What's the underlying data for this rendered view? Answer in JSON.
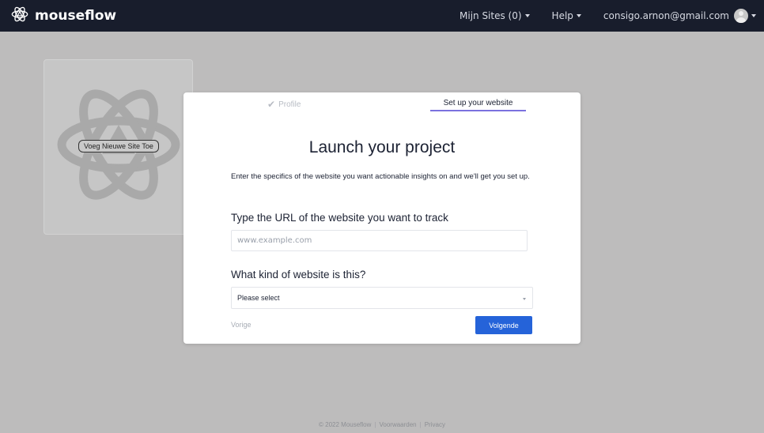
{
  "topbar": {
    "brand": "mouseflow",
    "logo_icon": "atom-logo-icon",
    "nav": {
      "sites": "Mijn Sites (0)",
      "help": "Help",
      "account": "consigo.arnon@gmail.com"
    }
  },
  "background": {
    "add_site_label": "Voeg Nieuwe Site Toe"
  },
  "wizard": {
    "steps": {
      "profile": "Profile",
      "website": "Set up your website"
    },
    "title": "Launch your project",
    "description": "Enter the specifics of the website you want actionable insights on and we'll get you set up.",
    "url_label": "Type the URL of the website you want to track",
    "url_placeholder": "www.example.com",
    "url_value": "",
    "kind_label": "What kind of website is this?",
    "kind_selected": "Please select",
    "prev_label": "Vorige",
    "next_label": "Volgende"
  },
  "footer": {
    "copyright": "© 2022 Mouseflow",
    "terms": "Voorwaarden",
    "privacy": "Privacy"
  },
  "colors": {
    "topbar": "#181d2c",
    "accent_underline": "#7b71df",
    "primary_button": "#2563d9",
    "overlay": "#bdbcbc"
  }
}
